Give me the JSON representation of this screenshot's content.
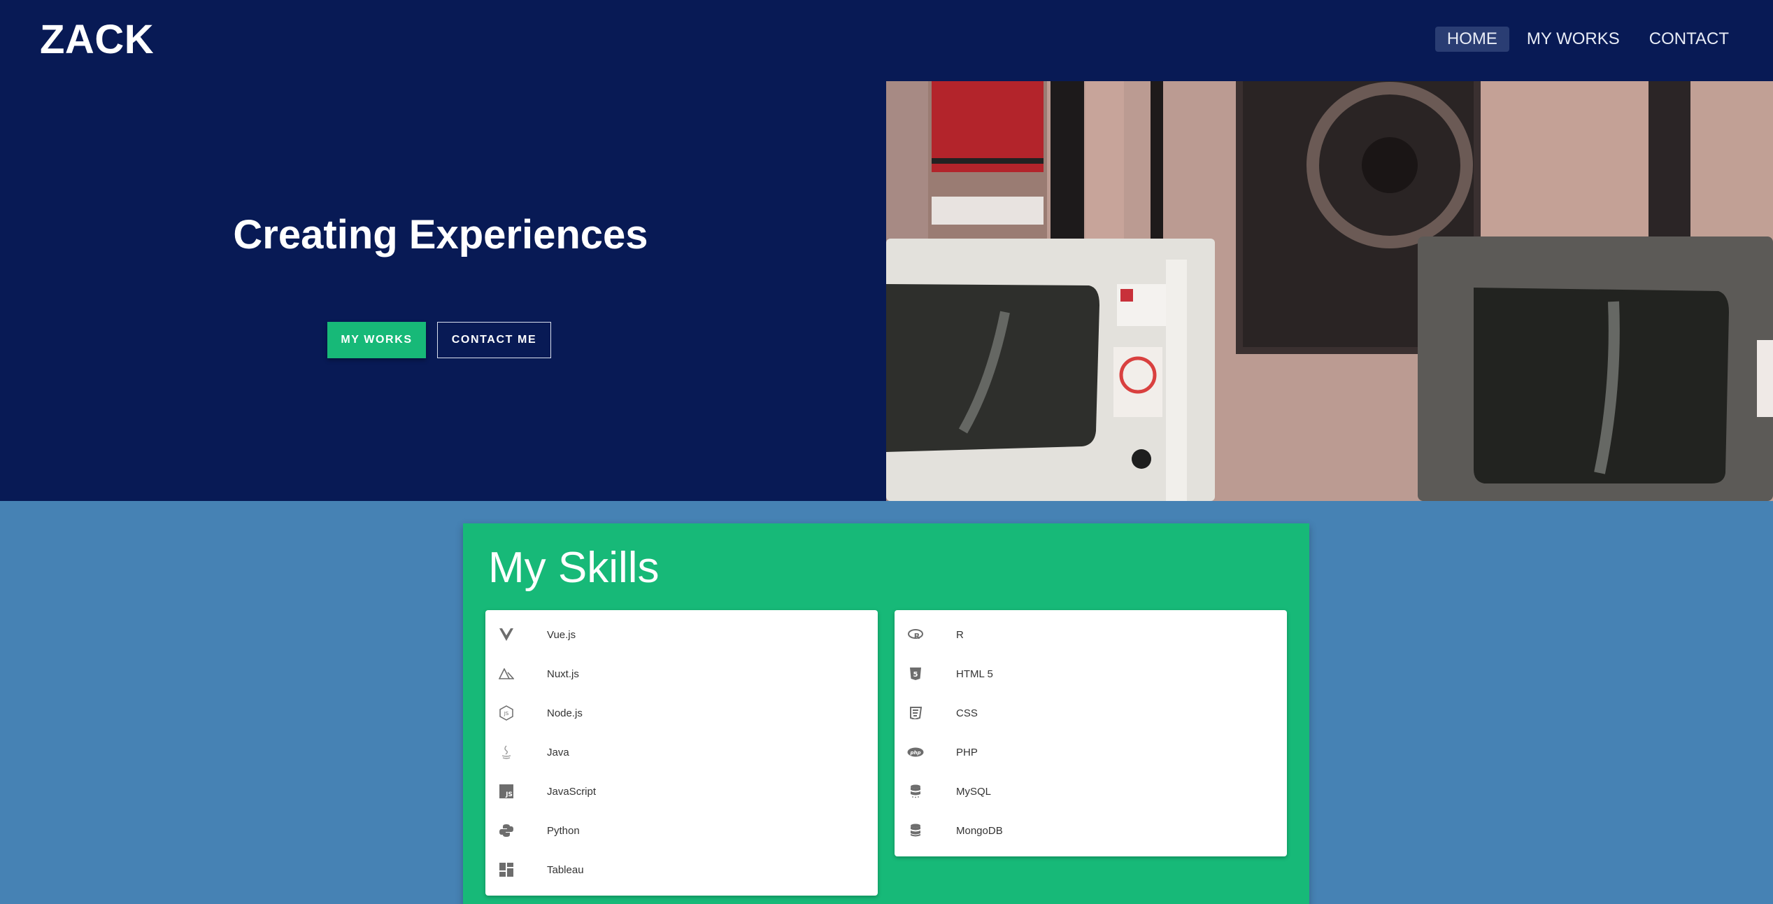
{
  "header": {
    "logo": "ZACK",
    "nav": [
      {
        "label": "HOME",
        "active": true
      },
      {
        "label": "MY WORKS",
        "active": false
      },
      {
        "label": "CONTACT",
        "active": false
      }
    ]
  },
  "hero": {
    "title": "Creating Experiences",
    "primary_button": "MY WORKS",
    "secondary_button": "CONTACT ME"
  },
  "skills": {
    "title": "My Skills",
    "left": [
      {
        "label": "Vue.js",
        "icon": "vuejs-icon"
      },
      {
        "label": "Nuxt.js",
        "icon": "nuxtjs-icon"
      },
      {
        "label": "Node.js",
        "icon": "nodejs-icon"
      },
      {
        "label": "Java",
        "icon": "java-icon"
      },
      {
        "label": "JavaScript",
        "icon": "javascript-icon"
      },
      {
        "label": "Python",
        "icon": "python-icon"
      },
      {
        "label": "Tableau",
        "icon": "tableau-icon"
      }
    ],
    "right": [
      {
        "label": "R",
        "icon": "r-language-icon"
      },
      {
        "label": "HTML 5",
        "icon": "html5-icon"
      },
      {
        "label": "CSS",
        "icon": "css3-icon"
      },
      {
        "label": "PHP",
        "icon": "php-icon"
      },
      {
        "label": "MySQL",
        "icon": "database-icon"
      },
      {
        "label": "MongoDB",
        "icon": "database-icon"
      }
    ]
  },
  "colors": {
    "hero_bg": "#081a55",
    "page_bg": "#4682b4",
    "accent": "#17b978"
  }
}
